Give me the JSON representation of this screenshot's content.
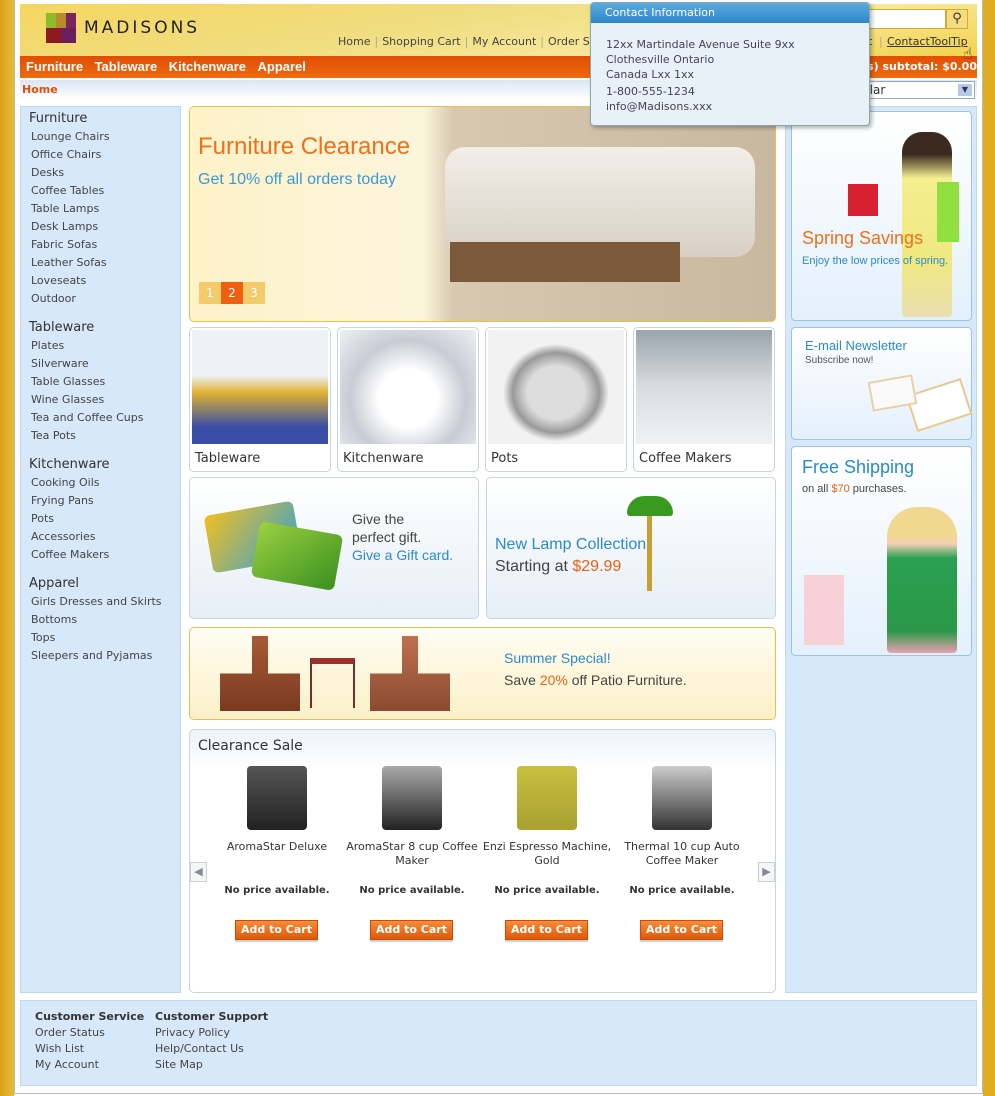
{
  "brand": {
    "name": "MADISONS"
  },
  "header": {
    "links": [
      "Home",
      "Shopping Cart",
      "My Account",
      "Order S"
    ],
    "links_right_fragment": "t",
    "contact_link": "ContactToolTip",
    "search_placeholder": "",
    "subtotal_fragment": "s) subtotal: $0.00",
    "currency_fragment": "ollar"
  },
  "nav": {
    "items": [
      "Furniture",
      "Tableware",
      "Kitchenware",
      "Apparel"
    ]
  },
  "breadcrumb": {
    "home": "Home"
  },
  "sidebar": {
    "categories": [
      {
        "label": "Furniture",
        "items": [
          "Lounge Chairs",
          "Office Chairs",
          "Desks",
          "Coffee Tables",
          "Table Lamps",
          "Desk Lamps",
          "Fabric Sofas",
          "Leather Sofas",
          "Loveseats",
          "Outdoor"
        ]
      },
      {
        "label": "Tableware",
        "items": [
          "Plates",
          "Silverware",
          "Table Glasses",
          "Wine Glasses",
          "Tea and Coffee Cups",
          "Tea Pots"
        ]
      },
      {
        "label": "Kitchenware",
        "items": [
          "Cooking Oils",
          "Frying Pans",
          "Pots",
          "Accessories",
          "Coffee Makers"
        ]
      },
      {
        "label": "Apparel",
        "items": [
          "Girls Dresses and Skirts",
          "Bottoms",
          "Tops",
          "Sleepers and Pyjamas"
        ]
      }
    ]
  },
  "hero": {
    "title": "Furniture Clearance",
    "subtitle": "Get 10% off all orders today",
    "pages": [
      "1",
      "2",
      "3"
    ],
    "active_page": "2"
  },
  "tiles": [
    "Tableware",
    "Kitchenware",
    "Pots",
    "Coffee Makers"
  ],
  "gift": {
    "line1": "Give the",
    "line2": "perfect gift.",
    "line3": "Give a Gift card."
  },
  "lamp": {
    "title": "New Lamp Collection",
    "prefix": "Starting at ",
    "price": "$29.99"
  },
  "summer": {
    "title": "Summer Special!",
    "prefix": "Save ",
    "pct": "20%",
    "suffix": " off Patio Furniture."
  },
  "clearance": {
    "title": "Clearance Sale",
    "products": [
      {
        "name": "AromaStar Deluxe",
        "price": "No price available.",
        "button": "Add to Cart"
      },
      {
        "name": "AromaStar 8 cup Coffee Maker",
        "price": "No price available.",
        "button": "Add to Cart"
      },
      {
        "name": "Enzi Espresso Machine, Gold",
        "price": "No price available.",
        "button": "Add to Cart"
      },
      {
        "name": "Thermal 10 cup Auto Coffee Maker",
        "price": "No price available.",
        "button": "Add to Cart"
      }
    ]
  },
  "right": {
    "spring": {
      "title": "Spring Savings",
      "sub": "Enjoy the low prices of spring."
    },
    "newsletter": {
      "title": "E-mail Newsletter",
      "sub": "Subscribe now!"
    },
    "shipping": {
      "title": "Free Shipping",
      "prefix": "on all ",
      "amount": "$70",
      "suffix": " purchases."
    }
  },
  "footer": {
    "col1": {
      "title": "Customer Service",
      "items": [
        "Order Status",
        "Wish List",
        "My Account"
      ]
    },
    "col2": {
      "title": "Customer Support",
      "items": [
        "Privacy Policy",
        "Help/Contact Us",
        "Site Map"
      ]
    }
  },
  "tooltip": {
    "title": "Contact Information",
    "lines": [
      "12xx Martindale Avenue Suite 9xx",
      "Clothesville Ontario",
      "Canada Lxx 1xx",
      "1-800-555-1234",
      "info@Madisons.xxx"
    ]
  },
  "colors": {
    "accent": "#f06010",
    "blue": "#3a9ad8",
    "panel": "#d6e8fa"
  }
}
